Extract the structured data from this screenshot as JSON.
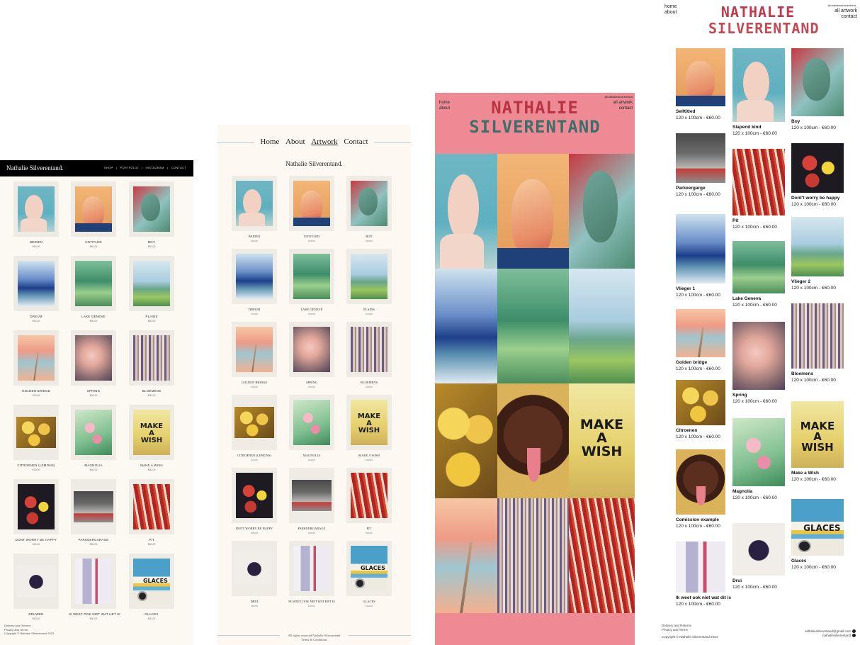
{
  "p1": {
    "brand": "Nathalie Silverentand.",
    "nav": [
      "SHOP",
      "PORTFOLIO",
      "INSTAGRAM",
      "CONTACT"
    ],
    "items": [
      {
        "title": "BEIDEN",
        "price": "€60,00"
      },
      {
        "title": "UNTITLED",
        "price": "€60,00"
      },
      {
        "title": "BOY",
        "price": "€60,00"
      },
      {
        "title": "DREUM",
        "price": "€50,00"
      },
      {
        "title": "LAKE GENEVE",
        "price": "€50,00"
      },
      {
        "title": "PLAINS",
        "price": "€50,00"
      },
      {
        "title": "GOLDEN BRIDGE",
        "price": "€90,00"
      },
      {
        "title": "SPRING",
        "price": "€90,00"
      },
      {
        "title": "BLOEMENS",
        "price": "€90,00"
      },
      {
        "title": "CITROENEN (LEMONS)",
        "price": "€50,00"
      },
      {
        "title": "MAGNOLIA",
        "price": "€60,00"
      },
      {
        "title": "MAKE A WISH",
        "price": "€80,00"
      },
      {
        "title": "DONT WORRY BE HAPPY",
        "price": "€90,00"
      },
      {
        "title": "PARKEERGARAGE",
        "price": "€90,00"
      },
      {
        "title": "PIT",
        "price": "€80,00"
      },
      {
        "title": "BRUWEN",
        "price": "€60,00"
      },
      {
        "title": "IK WEET OOK NIET WAT HET IS",
        "price": "€60,00"
      },
      {
        "title": "GLACES",
        "price": "€60,00"
      }
    ],
    "footer": [
      "Delivery and Returns",
      "Privacy and Terms",
      "Copyright © Nathalie Silverentand 2024"
    ]
  },
  "p2": {
    "nav": [
      "Home",
      "About",
      "Artwork",
      "Contact"
    ],
    "brand": "Nathalie Silverentand.",
    "items": [
      {
        "title": "BEIDEN",
        "price": "€60,00"
      },
      {
        "title": "UNTITLED",
        "price": "€60,00"
      },
      {
        "title": "BOY",
        "price": "€60,00"
      },
      {
        "title": "DREUM",
        "price": "€50,00"
      },
      {
        "title": "LAKE GENEVE",
        "price": "€50,00"
      },
      {
        "title": "PLAINS",
        "price": "€50,00"
      },
      {
        "title": "GOLDEN BRIDGE",
        "price": "€90,00"
      },
      {
        "title": "SPRING",
        "price": "€90,00"
      },
      {
        "title": "BLOEMENS",
        "price": "€90,00"
      },
      {
        "title": "CITROENEN (LEMONS)",
        "price": "€50,00"
      },
      {
        "title": "MAGNOLIA",
        "price": "€60,00"
      },
      {
        "title": "MAKE A WISH",
        "price": "€80,00"
      },
      {
        "title": "DONT WORRY BE HAPPY",
        "price": "€90,00"
      },
      {
        "title": "PARKEERGARAGE",
        "price": "€90,00"
      },
      {
        "title": "PIT",
        "price": "€80,00"
      },
      {
        "title": "DRUI",
        "price": "€60,00"
      },
      {
        "title": "IK WEET OOK NIET WAT HET IS",
        "price": "€60,00"
      },
      {
        "title": "GLACES",
        "price": "€60,00"
      }
    ],
    "footer": [
      "All rights reserved Nathalie Silverentand",
      "Terms & Conditions"
    ]
  },
  "p3": {
    "links": [
      "home",
      "about"
    ],
    "handle": "@nathaliesilverentand",
    "right_links": [
      "all artwork",
      "contact"
    ],
    "logo": [
      "NATHALIE",
      "SILVERENTAND"
    ]
  },
  "p4": {
    "links": [
      "home",
      "about"
    ],
    "handle": "@nathaliesilverentand",
    "right_links": [
      "all artwork",
      "contact"
    ],
    "logo": [
      "NATHALIE",
      "SILVERENTAND"
    ],
    "items": [
      {
        "title": "Selftitled",
        "price": "120 x 100cm - €60.00"
      },
      {
        "title": "Slapend kind",
        "price": "120 x 100cm - €60.00"
      },
      {
        "title": "Boy",
        "price": "120 x 100cm - €60.00"
      },
      {
        "title": "Parkeergarge",
        "price": "120 x 100cm - €60.00"
      },
      {
        "title": "Pit",
        "price": "120 x 100cm - €60.00"
      },
      {
        "title": "Dont't worry be happy",
        "price": "120 x 100cm - €60.00"
      },
      {
        "title": "Vlieger 1",
        "price": "120 x 100cm - €60.00"
      },
      {
        "title": "Lake Geneva",
        "price": "120 x 100cm - €60.00"
      },
      {
        "title": "Vlieger 2",
        "price": "120 x 100cm - €60.00"
      },
      {
        "title": "Golden bridge",
        "price": "120 x 100cm - €60.00"
      },
      {
        "title": "Spring",
        "price": "120 x 100cm - €60.00"
      },
      {
        "title": "Bloemens",
        "price": "120 x 100cm - €60.00"
      },
      {
        "title": "Citroenen",
        "price": "120 x 100cm - €60.00"
      },
      {
        "title": "Magnolia",
        "price": "120 x 100cm - €60.00"
      },
      {
        "title": "Make a Wish",
        "price": "120 x 100cm - €60.00"
      },
      {
        "title": "Comission example",
        "price": "120 x 100cm - €60.00"
      },
      {
        "title": "Drui",
        "price": "120 x 100cm - €60.00"
      },
      {
        "title": "Glaces",
        "price": "120 x 100cm - €60.00"
      },
      {
        "title": "Ik weet ook niet wat dit is",
        "price": "120 x 100cm - €60.00"
      }
    ],
    "footer": [
      "Delivery and Returns",
      "Privacy and Terms",
      "Copyright © Nathalie Silverentand 2024"
    ],
    "email": "nathaliesilverentand@gmail.com",
    "insta": "nathaliesilverentand"
  },
  "artwork": {
    "wish_text": "MAKE\nA\nWISH",
    "glaces_text": "GLACES"
  },
  "colors": {
    "p3_background": "#ed8a94",
    "p1_header": "#000000",
    "cream_background": "#fcf8f2"
  }
}
